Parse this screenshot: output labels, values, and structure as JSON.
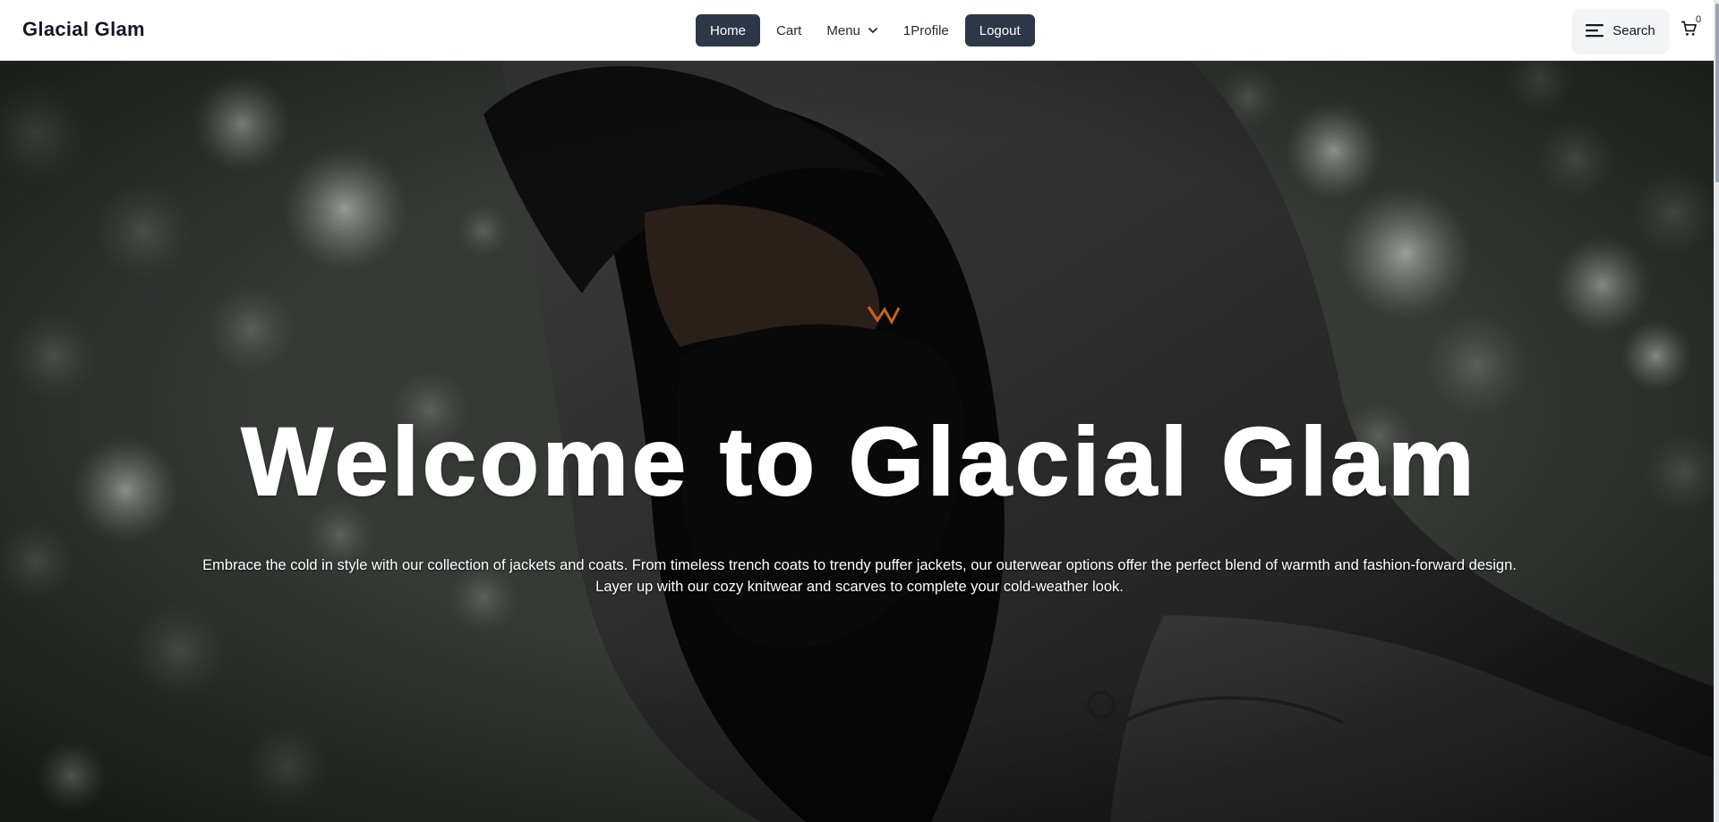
{
  "brand": {
    "name": "Glacial Glam"
  },
  "nav": {
    "home": "Home",
    "cart": "Cart",
    "menu": "Menu",
    "profile": "1Profile",
    "logout": "Logout"
  },
  "search": {
    "label": "Search"
  },
  "cart": {
    "count": "0"
  },
  "hero": {
    "title": "Welcome to Glacial Glam",
    "description": "Embrace the cold in style with our collection of jackets and coats. From timeless trench coats to trendy puffer jackets, our outerwear options offer the perfect blend of warmth and fashion-forward design. Layer up with our cozy knitwear and scarves to complete your cold-weather look."
  },
  "colors": {
    "nav_active_bg": "#2d3748",
    "nav_text": "#1f2937",
    "hero_text": "#ffffff"
  },
  "icons": [
    "menu-lines-icon",
    "cart-icon",
    "chevron-down-icon"
  ]
}
